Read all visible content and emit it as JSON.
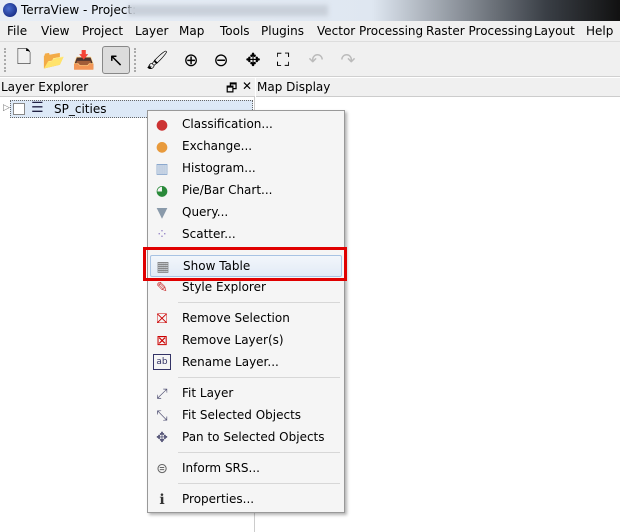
{
  "window": {
    "title": "TerraView - Project:"
  },
  "menubar": [
    "File",
    "View",
    "Project",
    "Layer",
    "Map",
    "Tools",
    "Plugins",
    "Vector Processing",
    "Raster Processing",
    "Layout",
    "Help"
  ],
  "toolbar": [
    {
      "icon": "new-project-icon",
      "glyph": "🗋"
    },
    {
      "icon": "open-folder-icon",
      "glyph": "📂"
    },
    {
      "icon": "save-icon",
      "glyph": "📥"
    },
    {
      "icon": "selection-pointer-icon",
      "glyph": "↖",
      "active": true
    },
    {
      "icon": "paint-brush-icon",
      "glyph": "🖌"
    },
    {
      "icon": "zoom-in-icon",
      "glyph": "⊕"
    },
    {
      "icon": "zoom-out-icon",
      "glyph": "⊖"
    },
    {
      "icon": "pan-icon",
      "glyph": "✥"
    },
    {
      "icon": "zoom-extent-icon",
      "glyph": "⛶"
    },
    {
      "icon": "undo-icon",
      "glyph": "↶"
    },
    {
      "icon": "redo-icon",
      "glyph": "↷"
    }
  ],
  "layer_explorer": {
    "title": "Layer Explorer",
    "layer": "SP_cities",
    "checked": false
  },
  "map_display": {
    "title": "Map Display"
  },
  "context_menu": {
    "highlighted": "Show Table",
    "highlight_color": "#e00000",
    "items": [
      {
        "label": "Classification...",
        "icon": "classification-icon",
        "glyph": "●",
        "color": "#c33"
      },
      {
        "label": "Exchange...",
        "icon": "exchange-icon",
        "glyph": "●",
        "color": "#e89a3c"
      },
      {
        "label": "Histogram...",
        "icon": "histogram-icon",
        "glyph": "▥",
        "color": "#7a9cc8"
      },
      {
        "label": "Pie/Bar Chart...",
        "icon": "pie-chart-icon",
        "glyph": "◕",
        "color": "#2a8a3a"
      },
      {
        "label": "Query...",
        "icon": "filter-icon",
        "glyph": "▼",
        "color": "#8a9aaa"
      },
      {
        "label": "Scatter...",
        "icon": "scatter-icon",
        "glyph": "⁘",
        "color": "#9a8ac8"
      },
      {
        "label": "Show Table",
        "icon": "table-icon",
        "glyph": "▦",
        "color": "#777"
      },
      {
        "label": "Style Explorer",
        "icon": "style-icon",
        "glyph": "✎",
        "color": "#c33"
      },
      {
        "label": "Remove Selection",
        "icon": "remove-selection-icon",
        "glyph": "⛝",
        "color": "#c00"
      },
      {
        "label": "Remove Layer(s)",
        "icon": "remove-layer-icon",
        "glyph": "⊠",
        "color": "#c00"
      },
      {
        "label": "Rename Layer...",
        "icon": "rename-icon",
        "glyph": "ab",
        "color": "#336"
      },
      {
        "label": "Fit Layer",
        "icon": "fit-layer-icon",
        "glyph": "⤢",
        "color": "#557"
      },
      {
        "label": "Fit Selected Objects",
        "icon": "fit-selected-icon",
        "glyph": "⤡",
        "color": "#557"
      },
      {
        "label": "Pan to Selected Objects",
        "icon": "pan-selected-icon",
        "glyph": "✥",
        "color": "#557"
      },
      {
        "label": "Inform SRS...",
        "icon": "srs-icon",
        "glyph": "⊜",
        "color": "#666"
      },
      {
        "label": "Properties...",
        "icon": "properties-icon",
        "glyph": "ℹ",
        "color": "#333"
      }
    ]
  }
}
